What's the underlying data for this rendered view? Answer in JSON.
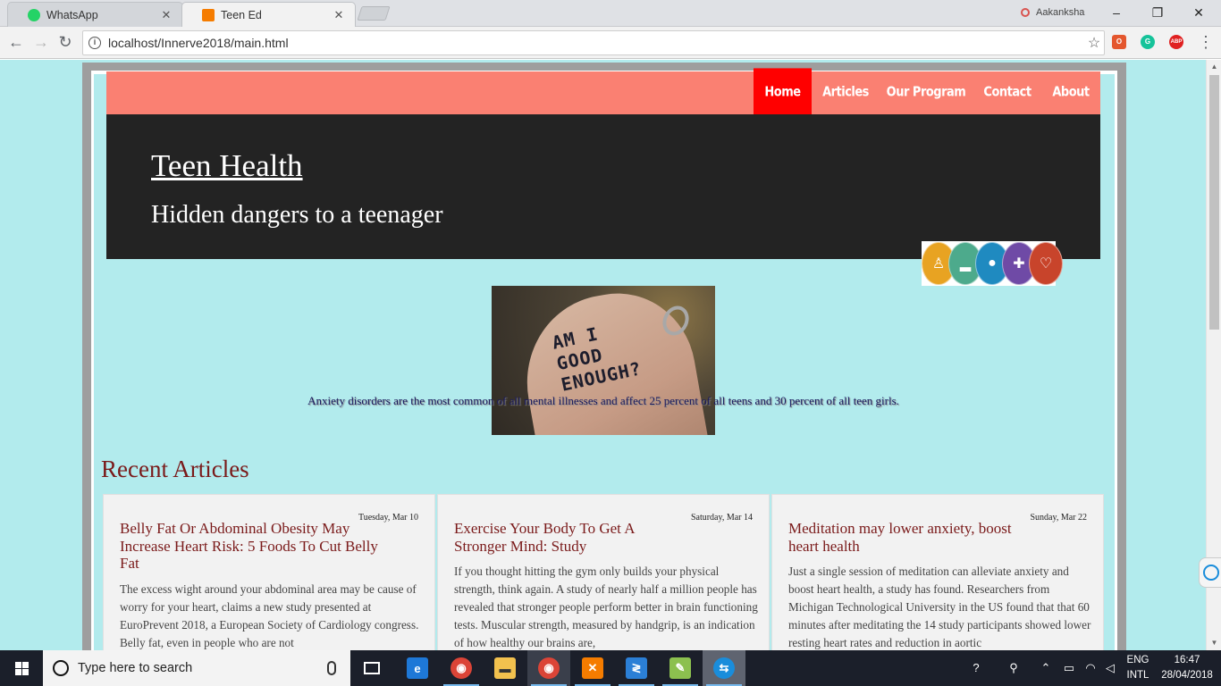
{
  "browser": {
    "tabs": [
      {
        "title": "WhatsApp",
        "close": "✕"
      },
      {
        "title": "Teen Ed",
        "close": "✕"
      }
    ],
    "profile_name": "Aakanksha",
    "window_controls": {
      "minimize": "–",
      "restore": "❐",
      "close": "✕"
    },
    "address_bar": {
      "url": "localhost/Innerve2018/main.html"
    },
    "nav": {
      "back": "←",
      "forward": "→",
      "reload": "↻",
      "star": "☆",
      "menu": "⋮"
    },
    "extensions": {
      "office": "O",
      "grammarly": "G",
      "adblock": "ABP"
    }
  },
  "site": {
    "nav": [
      "Home",
      "Articles",
      "Our Program",
      "Contact",
      "About"
    ],
    "active_nav": "Home",
    "title": "Teen Health",
    "subtitle": "Hidden dangers to a teenager",
    "feature_image_text": [
      "AM I",
      "GOOD",
      "ENOUGH?"
    ],
    "feature_caption": "Anxiety disorders are the most common of all mental illnesses and affect 25 percent of all teens and 30 percent of all teen girls.",
    "recent_heading": "Recent Articles",
    "articles": [
      {
        "date": "Tuesday, Mar 10",
        "title": "Belly Fat Or Abdominal Obesity May Increase Heart Risk: 5 Foods To Cut Belly Fat",
        "body": "The excess wight around your abdominal area may be cause of worry for your heart, claims a new study presented at EuroPrevent 2018, a European Society of Cardiology congress. Belly fat, even in people who are not"
      },
      {
        "date": "Saturday, Mar 14",
        "title": "Exercise Your Body To Get A Stronger Mind: Study",
        "body": "If you thought hitting the gym only builds your physical strength, think again. A study of nearly half a million people has revealed that stronger people perform better in brain functioning tests. Muscular strength, measured by handgrip, is an indication of how healthy our brains are,"
      },
      {
        "date": "Sunday, Mar 22",
        "title": "Meditation may lower anxiety, boost heart health",
        "body": "Just a single session of meditation can alleviate anxiety and boost heart health, a study has found. Researchers from Michigan Technological University in the US found that that 60 minutes after meditating the 14 study participants showed lower resting heart rates and reduction in aortic"
      }
    ],
    "health_icons": [
      "yoga-icon",
      "bed-icon",
      "apple-icon",
      "person-icon",
      "heart-icon"
    ]
  },
  "taskbar": {
    "search_placeholder": "Type here to search",
    "tray": {
      "language_line1": "ENG",
      "language_line2": "INTL",
      "time": "16:47",
      "date": "28/04/2018"
    }
  },
  "colors": {
    "page_bg": "#b2ebed",
    "navbar": "#fa8072",
    "nav_active": "#ff0000",
    "hero_bg": "#232323",
    "heading": "#7a1a1a"
  }
}
